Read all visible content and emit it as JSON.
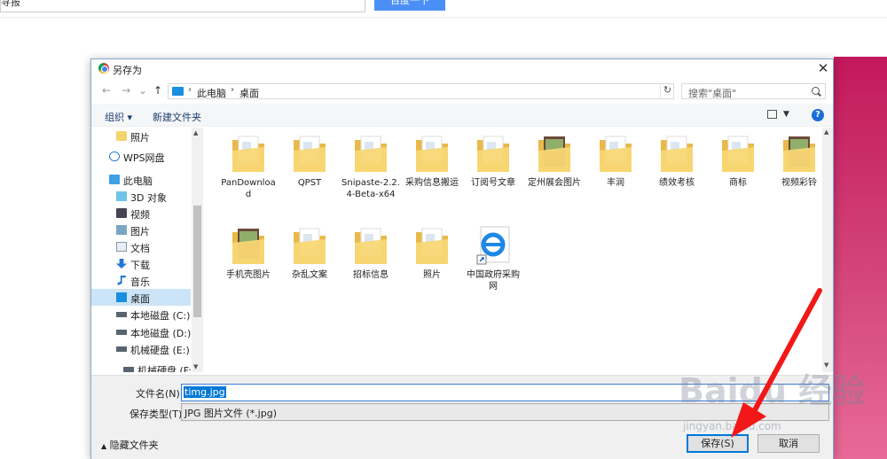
{
  "background": {
    "search_text": "寻报",
    "button_text": "百度一下"
  },
  "dialog": {
    "title": "另存为",
    "close_glyph": "✕",
    "nav": {
      "back": "←",
      "forward": "→",
      "recent": "⌄",
      "up": "↑"
    },
    "address": {
      "parts": [
        "此电脑",
        "桌面"
      ],
      "separator": "›"
    },
    "refresh_glyph": "↻",
    "search_placeholder": "搜索\"桌面\"",
    "commands": {
      "organize": "组织 ▾",
      "new_folder": "新建文件夹"
    },
    "help": "?",
    "sidebar": [
      {
        "label": "照片",
        "icon": "folder-icon"
      },
      {
        "label": "WPS网盘",
        "icon": "cloud-icon"
      },
      {
        "label": "此电脑",
        "icon": "computer-icon"
      },
      {
        "label": "3D 对象",
        "icon": "cube-icon"
      },
      {
        "label": "视频",
        "icon": "video-icon"
      },
      {
        "label": "图片",
        "icon": "picture-icon"
      },
      {
        "label": "文档",
        "icon": "document-icon"
      },
      {
        "label": "下载",
        "icon": "download-icon"
      },
      {
        "label": "音乐",
        "icon": "music-icon"
      },
      {
        "label": "桌面",
        "icon": "desktop-icon",
        "selected": true
      },
      {
        "label": "本地磁盘 (C:)",
        "icon": "drive-icon"
      },
      {
        "label": "本地磁盘 (D:)",
        "icon": "drive-icon"
      },
      {
        "label": "机械硬盘 (E:)",
        "icon": "drive-icon"
      },
      {
        "label": "机械硬盘 (F:)",
        "icon": "drive-icon"
      }
    ],
    "files": [
      {
        "name": "PanDownload",
        "kind": "folder"
      },
      {
        "name": "QPST",
        "kind": "folder"
      },
      {
        "name": "Snipaste-2.2.4-Beta-x64",
        "kind": "folder"
      },
      {
        "name": "采购信息搬运",
        "kind": "folder"
      },
      {
        "name": "订阅号文章",
        "kind": "folder"
      },
      {
        "name": "定州展会图片",
        "kind": "photo-folder"
      },
      {
        "name": "丰润",
        "kind": "folder"
      },
      {
        "name": "绩效考核",
        "kind": "folder"
      },
      {
        "name": "商标",
        "kind": "folder"
      },
      {
        "name": "视频彩铃",
        "kind": "photo-folder"
      },
      {
        "name": "手机壳图片",
        "kind": "photo-folder"
      },
      {
        "name": "杂乱文案",
        "kind": "folder"
      },
      {
        "name": "招标信息",
        "kind": "folder"
      },
      {
        "name": "照片",
        "kind": "folder"
      },
      {
        "name": "中国政府采购网",
        "kind": "ie-shortcut"
      }
    ],
    "filename_label": "文件名(N):",
    "filename_value": "timg.jpg",
    "filetype_label": "保存类型(T):",
    "filetype_value": "JPG 图片文件 (*.jpg)",
    "hide_folders": "隐藏文件夹",
    "save_button": "保存(S)",
    "cancel_button": "取消"
  },
  "watermark": {
    "main": "Baidu 经验",
    "sub": "jingyan.baidu.com"
  }
}
